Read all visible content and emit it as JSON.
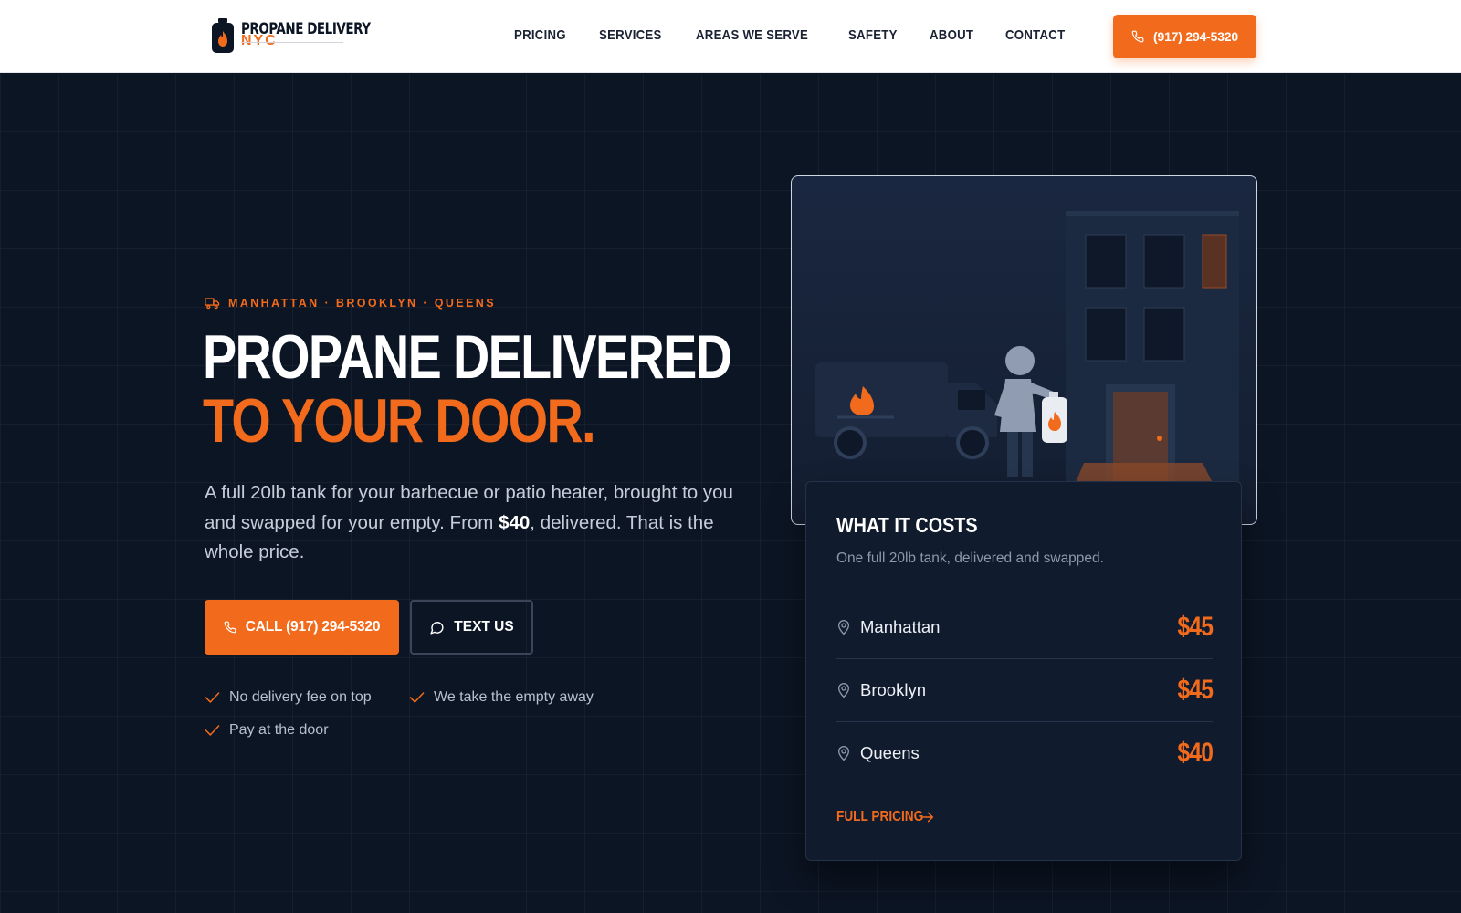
{
  "brand": {
    "name_line1": "PROPANE DELIVERY",
    "name_line2": "NYC",
    "accent": "#f26a1b",
    "dark": "#0c1524"
  },
  "nav": {
    "items": [
      {
        "label": "PRICING"
      },
      {
        "label": "SERVICES"
      },
      {
        "label": "AREAS WE SERVE"
      },
      {
        "label": "SAFETY"
      },
      {
        "label": "ABOUT"
      },
      {
        "label": "CONTACT"
      }
    ],
    "cta_phone": "(917) 294-5320",
    "cta_icon": "phone-icon"
  },
  "hero": {
    "eyebrow": "MANHATTAN · BROOKLYN · QUEENS",
    "eyebrow_icon": "truck-icon",
    "headline_line1": "PROPANE DELIVERED",
    "headline_line2": "TO YOUR DOOR.",
    "lead_before": "A full 20lb tank for your barbecue or patio heater, brought to you and swapped for your empty. From ",
    "lead_price": "$40",
    "lead_after": ", delivered. That is the whole price.",
    "call_label": "CALL (917) 294-5320",
    "text_label": "TEXT US",
    "perks": [
      "No delivery fee on top",
      "We take the empty away",
      "Pay at the door"
    ]
  },
  "pricing_card": {
    "title": "WHAT IT COSTS",
    "subtitle": "One full 20lb tank, delivered and swapped.",
    "rows": [
      {
        "area": "Manhattan",
        "price": "$45"
      },
      {
        "area": "Brooklyn",
        "price": "$45"
      },
      {
        "area": "Queens",
        "price": "$40"
      }
    ],
    "link_label": "FULL PRICING"
  }
}
